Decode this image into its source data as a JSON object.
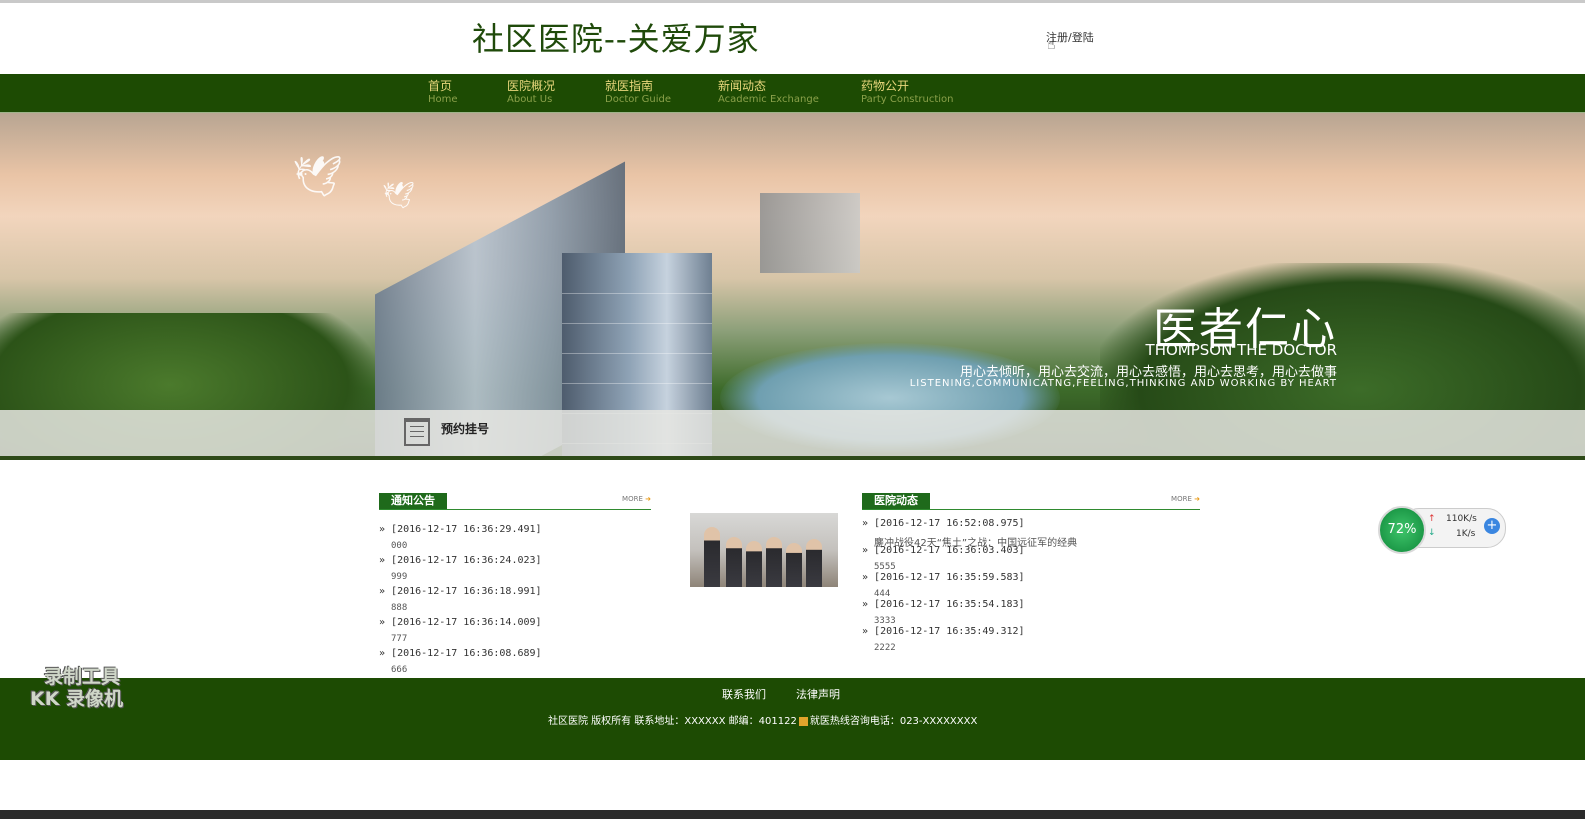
{
  "header": {
    "site_title": "社区医院--关爱万家",
    "login_link": "注册/登陆"
  },
  "nav": [
    {
      "cn": "首页",
      "en": "Home"
    },
    {
      "cn": "医院概况",
      "en": "About Us"
    },
    {
      "cn": "就医指南",
      "en": "Doctor Guide"
    },
    {
      "cn": "新闻动态",
      "en": "Academic Exchange"
    },
    {
      "cn": "药物公开",
      "en": "Party Construction"
    }
  ],
  "banner": {
    "slogan_cn": "医者仁心",
    "slogan_en": "THOMPSON  THE DOCTOR",
    "slogan_sub": "用心去倾听，用心去交流，用心去感悟，用心去思考，用心去做事",
    "slogan_sub_en": "LISTENING,COMMUNICATNG,FEELING,THINKING AND WORKING BY HEART",
    "appointment": "预约挂号"
  },
  "notices": {
    "title": "通知公告",
    "more": "MORE",
    "items": [
      {
        "date": "[2016-12-17 16:36:29.491]",
        "text": "000"
      },
      {
        "date": "[2016-12-17 16:36:24.023]",
        "text": "999"
      },
      {
        "date": "[2016-12-17 16:36:18.991]",
        "text": "888"
      },
      {
        "date": "[2016-12-17 16:36:14.009]",
        "text": "777"
      },
      {
        "date": "[2016-12-17 16:36:08.689]",
        "text": "666"
      }
    ]
  },
  "hospital_news": {
    "title": "医院动态",
    "more": "MORE",
    "items": [
      {
        "date": "[2016-12-17 16:52:08.975]",
        "text": "鏖冲战役42天“焦土”之战：中国远征军的经典"
      },
      {
        "date": "[2016-12-17 16:36:03.403]",
        "text": "5555"
      },
      {
        "date": "[2016-12-17 16:35:59.583]",
        "text": "444"
      },
      {
        "date": "[2016-12-17 16:35:54.183]",
        "text": "3333"
      },
      {
        "date": "[2016-12-17 16:35:49.312]",
        "text": "2222"
      }
    ]
  },
  "footer": {
    "contact": "联系我们",
    "legal": "法律声明",
    "copyright_a": "社区医院 版权所有 联系地址：XXXXXX 邮编：401122",
    "copyright_b": "就医热线咨询电话：023-XXXXXXXX"
  },
  "overlay": {
    "watermark_line1": "录制工具",
    "watermark_line2": "KK 录像机",
    "speed_percent": "72%",
    "upload": "110K/s",
    "download": "1K/s"
  }
}
